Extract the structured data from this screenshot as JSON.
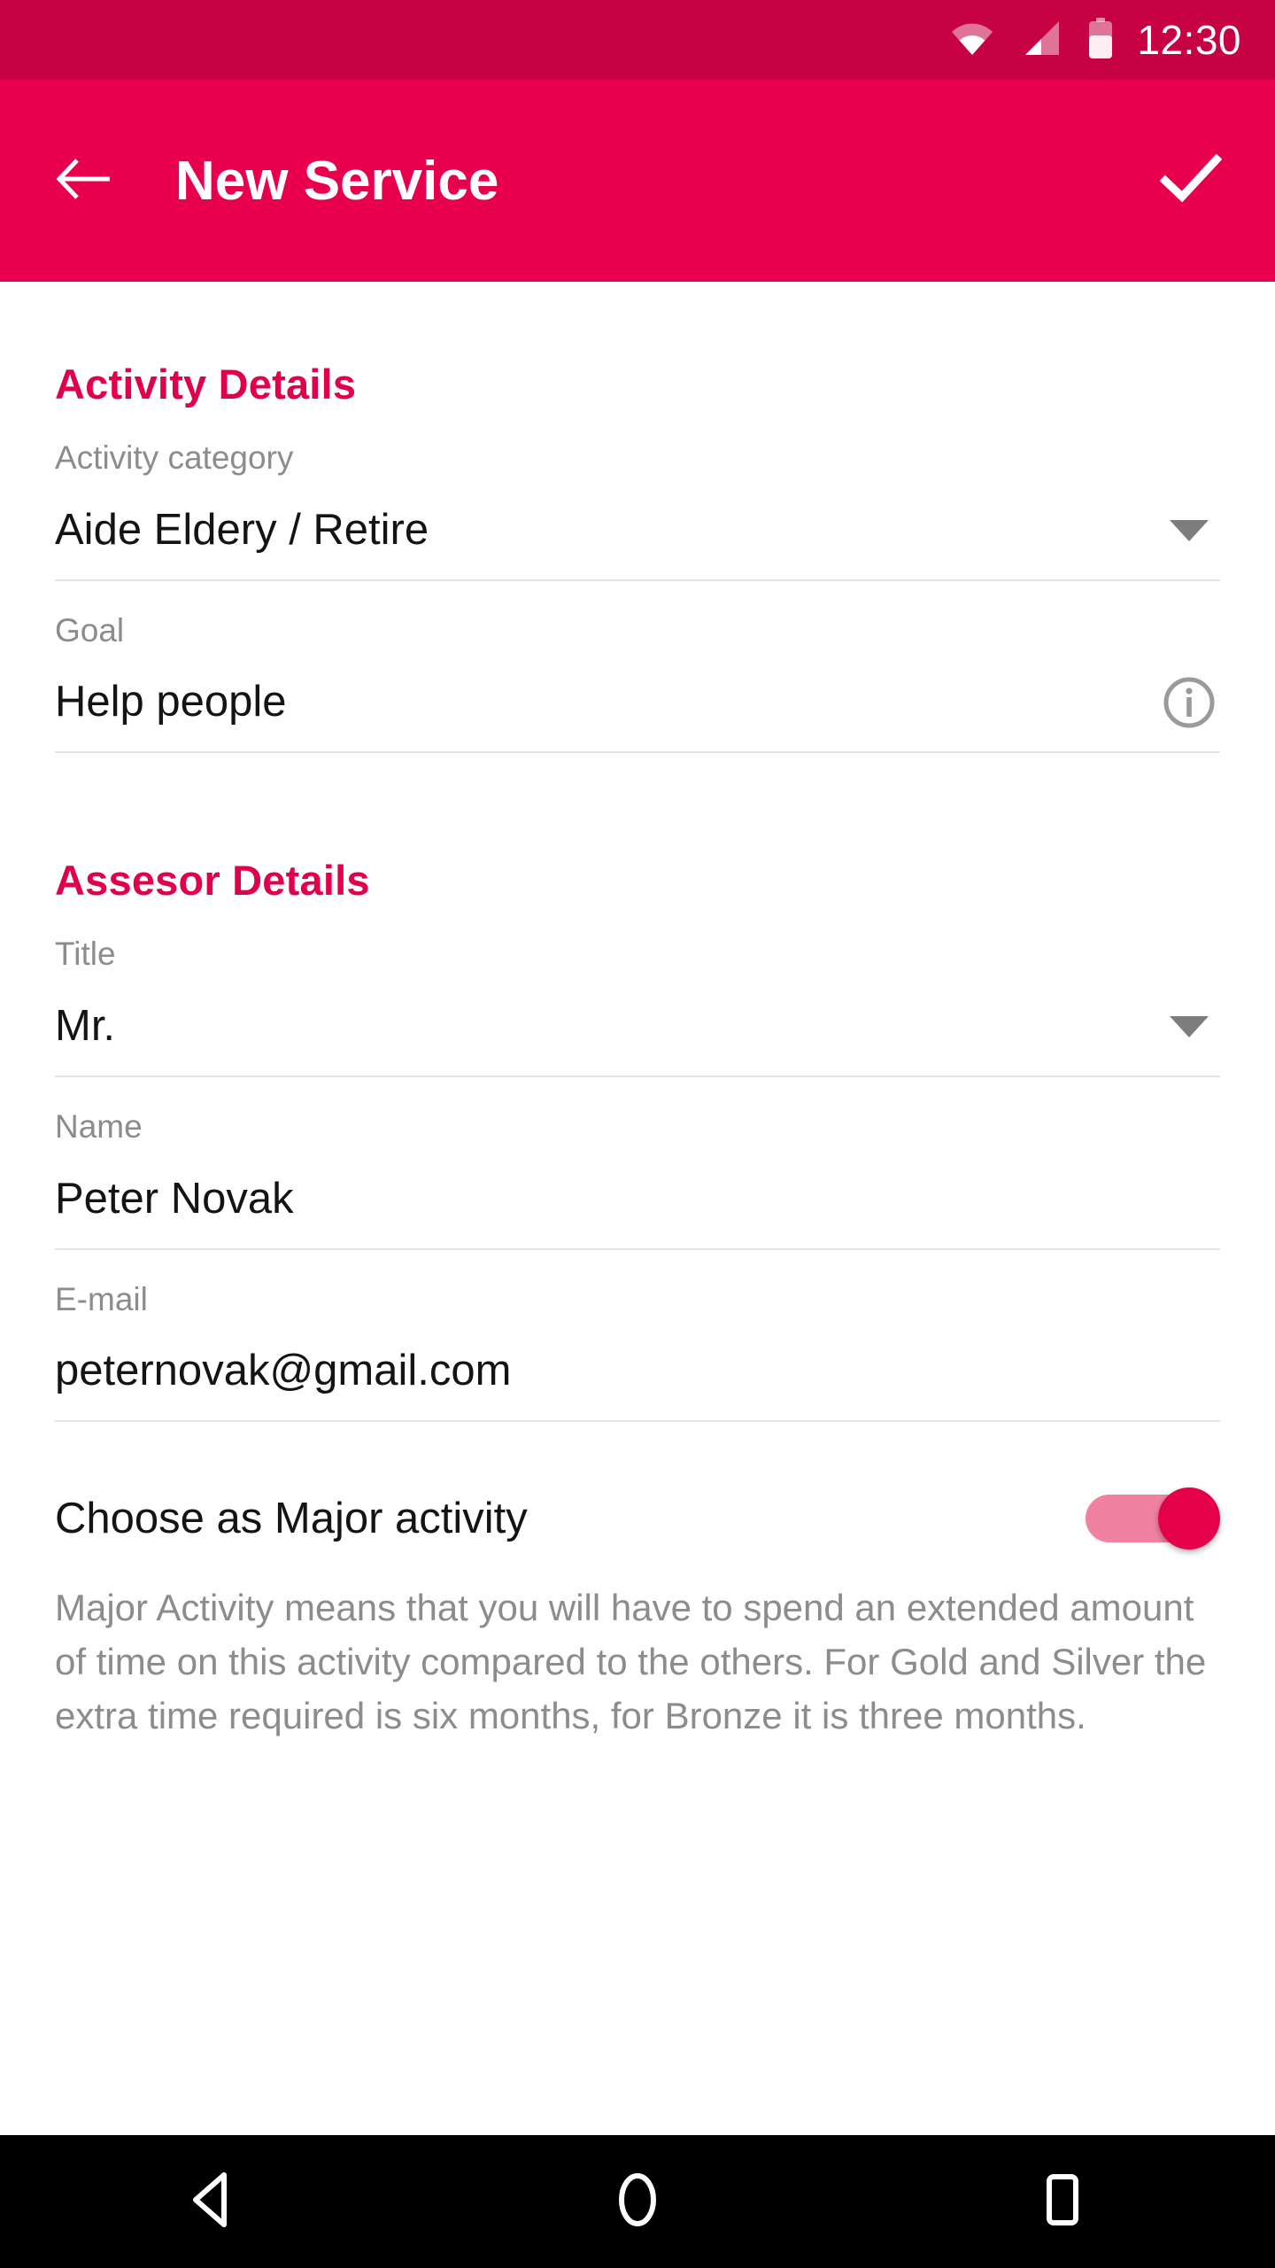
{
  "status_bar": {
    "time": "12:30",
    "icons": [
      "wifi-icon",
      "cellular-signal-icon",
      "battery-icon"
    ],
    "background_color": "#c70244"
  },
  "app_bar": {
    "title": "New Service",
    "back_icon": "arrow-left-icon",
    "confirm_icon": "check-icon",
    "background_color": "#e8004f",
    "text_color": "#ffffff"
  },
  "theme": {
    "accent_color": "#e0004d",
    "label_color": "#8c8c8c",
    "value_color": "#141414",
    "divider_color": "#e4e4e4"
  },
  "sections": [
    {
      "title": "Activity Details",
      "fields": [
        {
          "label": "Activity category",
          "value": "Aide Eldery / Retire",
          "trailing_icon": "chevron-down-icon",
          "type": "dropdown"
        },
        {
          "label": "Goal",
          "value": "Help people",
          "trailing_icon": "info-icon",
          "type": "text"
        }
      ]
    },
    {
      "title": "Assesor Details",
      "fields": [
        {
          "label": "Title",
          "value": "Mr.",
          "trailing_icon": "chevron-down-icon",
          "type": "dropdown"
        },
        {
          "label": "Name",
          "value": "Peter Novak",
          "trailing_icon": "",
          "type": "text"
        },
        {
          "label": "E-mail",
          "value": "peternovak@gmail.com",
          "trailing_icon": "",
          "type": "text"
        }
      ]
    }
  ],
  "major_activity": {
    "label": "Choose as Major activity",
    "toggle_on": true,
    "toggle_track_color": "#f0829f",
    "toggle_thumb_color": "#e5004c",
    "description": "Major Activity means that you will have to spend an extended amount of time on this activity compared to the others. For Gold and Silver the extra time required is six months, for Bronze it is three months."
  },
  "nav_bar": {
    "background_color": "#000000",
    "buttons": [
      "back-triangle-icon",
      "home-circle-icon",
      "recents-square-icon"
    ]
  }
}
